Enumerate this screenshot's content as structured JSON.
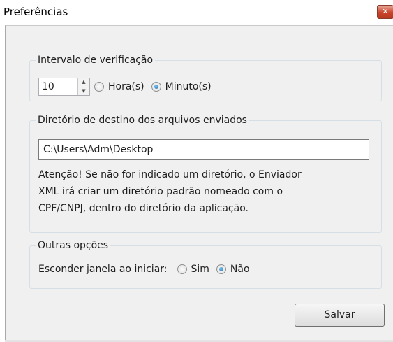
{
  "window": {
    "title": "Preferências",
    "close_glyph": "✕"
  },
  "interval_group": {
    "legend": "Intervalo de verificação",
    "spinner_value": "10",
    "options": [
      {
        "label": "Hora(s)",
        "checked": false
      },
      {
        "label": "Minuto(s)",
        "checked": true
      }
    ]
  },
  "directory_group": {
    "legend": "Diretório de destino dos arquivos enviados",
    "path_value": "C:\\Users\\Adm\\Desktop",
    "note_lines": [
      "Atenção! Se não for indicado um diretório, o Enviador",
      "XML irá criar um diretório padrão nomeado com o",
      "CPF/CNPJ, dentro do diretório da aplicação."
    ]
  },
  "other_group": {
    "legend": "Outras opções",
    "hide_label": "Esconder janela ao iniciar:",
    "options": [
      {
        "label": "Sim",
        "checked": false
      },
      {
        "label": "Não",
        "checked": true
      }
    ]
  },
  "actions": {
    "save_label": "Salvar"
  }
}
